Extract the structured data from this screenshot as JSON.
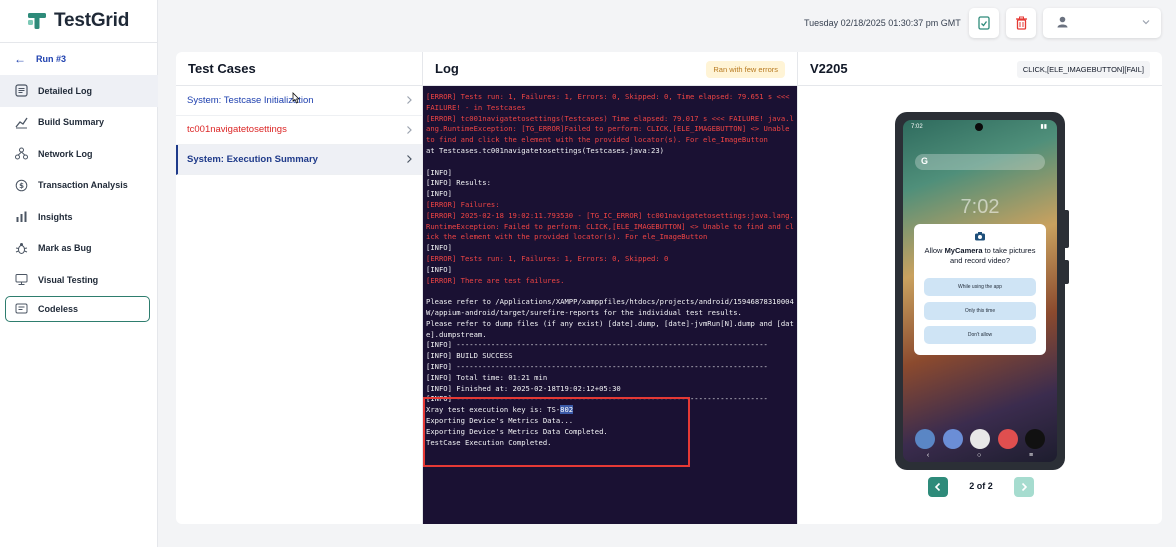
{
  "app": {
    "name": "TestGrid"
  },
  "header": {
    "datetime": "Tuesday 02/18/2025 01:30:37 pm GMT"
  },
  "sidebar": {
    "back_label": "Run #3",
    "items": [
      {
        "label": "Detailed Log",
        "icon": "log-icon",
        "active": true
      },
      {
        "label": "Build Summary",
        "icon": "chart-line-icon"
      },
      {
        "label": "Network Log",
        "icon": "network-icon"
      },
      {
        "label": "Transaction Analysis",
        "icon": "transaction-icon"
      },
      {
        "label": "Insights",
        "icon": "bar-chart-icon"
      },
      {
        "label": "Mark as Bug",
        "icon": "bug-icon"
      },
      {
        "label": "Visual Testing",
        "icon": "monitor-icon"
      },
      {
        "label": "Codeless",
        "icon": "codeless-icon"
      }
    ]
  },
  "test_cases": {
    "title": "Test Cases",
    "items": [
      {
        "label": "System: Testcase Initialization",
        "status": "info"
      },
      {
        "label": "tc001navigatetosettings",
        "status": "fail"
      },
      {
        "label": "System: Execution Summary",
        "status": "selected"
      }
    ]
  },
  "log": {
    "title": "Log",
    "badge": "Ran with few errors",
    "lines": [
      {
        "t": "[ERROR] Tests run: 1, Failures: 1, Errors: 0, Skipped: 0, Time elapsed: 79.651 s <<< FAILURE! - in Testcases",
        "err": true
      },
      {
        "t": "[ERROR] tc001navigatetosettings(Testcases) Time elapsed: 79.017 s <<< FAILURE! java.lang.RuntimeException: [TG_ERROR]Failed to perform: CLICK,[ELE_IMAGEBUTTON] <> Unable to find and click the element with the provided locator(s). For ele_ImageButton",
        "err": true
      },
      {
        "t": "at Testcases.tc001navigatetosettings(Testcases.java:23)",
        "err": false
      },
      {
        "t": " ",
        "err": false
      },
      {
        "t": "[INFO]",
        "err": false
      },
      {
        "t": "[INFO] Results:",
        "err": false
      },
      {
        "t": "[INFO]",
        "err": false
      },
      {
        "t": "[ERROR] Failures:",
        "err": true
      },
      {
        "t": "[ERROR] 2025-02-18 19:02:11.793530 - [TG_IC_ERROR] tc001navigatetosettings:java.lang.RuntimeException: Failed to perform: CLICK,[ELE_IMAGEBUTTON] <> Unable to find and click the element with the provided locator(s). For ele_ImageButton",
        "err": true
      },
      {
        "t": "[INFO]",
        "err": false
      },
      {
        "t": "[ERROR] Tests run: 1, Failures: 1, Errors: 0, Skipped: 0",
        "err": true
      },
      {
        "t": "[INFO]",
        "err": false
      },
      {
        "t": "[ERROR] There are test failures.",
        "err": true
      },
      {
        "t": " ",
        "err": false
      },
      {
        "t": "Please refer to /Applications/XAMPP/xamppfiles/htdocs/projects/android/15946878310004W/appium-android/target/surefire-reports for the individual test results.",
        "err": false
      },
      {
        "t": "Please refer to dump files (if any exist) [date].dump, [date]-jvmRun[N].dump and [date].dumpstream.",
        "err": false
      },
      {
        "t": "[INFO] ------------------------------------------------------------------------",
        "err": false
      },
      {
        "t": "[INFO] BUILD SUCCESS",
        "err": false
      },
      {
        "t": "[INFO] ------------------------------------------------------------------------",
        "err": false
      },
      {
        "t": "[INFO] Total time: 01:21 min",
        "err": false
      },
      {
        "t": "[INFO] Finished at: 2025-02-18T19:02:12+05:30",
        "err": false
      },
      {
        "t": "[INFO] ------------------------------------------------------------------------",
        "err": false
      }
    ],
    "xray_prefix": "Xray test execution key is: TS-",
    "xray_key": "802",
    "tail_lines": [
      "Exporting Device's Metrics Data...",
      "Exporting Device's Metrics Data Completed.",
      "TestCase Execution Completed."
    ]
  },
  "device": {
    "title": "V2205",
    "action_badge": "CLICK,[ELE_IMAGEBUTTON][FAIL]",
    "status_time": "7:02",
    "clock": "7:02",
    "dialog": {
      "text_pre": "Allow ",
      "app": "MyCamera",
      "text_post": " to take pictures and record video?",
      "buttons": [
        "While using the app",
        "Only this time",
        "Don't allow"
      ]
    },
    "pager": "2 of 2"
  },
  "colors": {
    "accent": "#2e8b7a",
    "link": "#1e40af",
    "error": "#ef4444",
    "terminal_bg": "#1a1133"
  }
}
